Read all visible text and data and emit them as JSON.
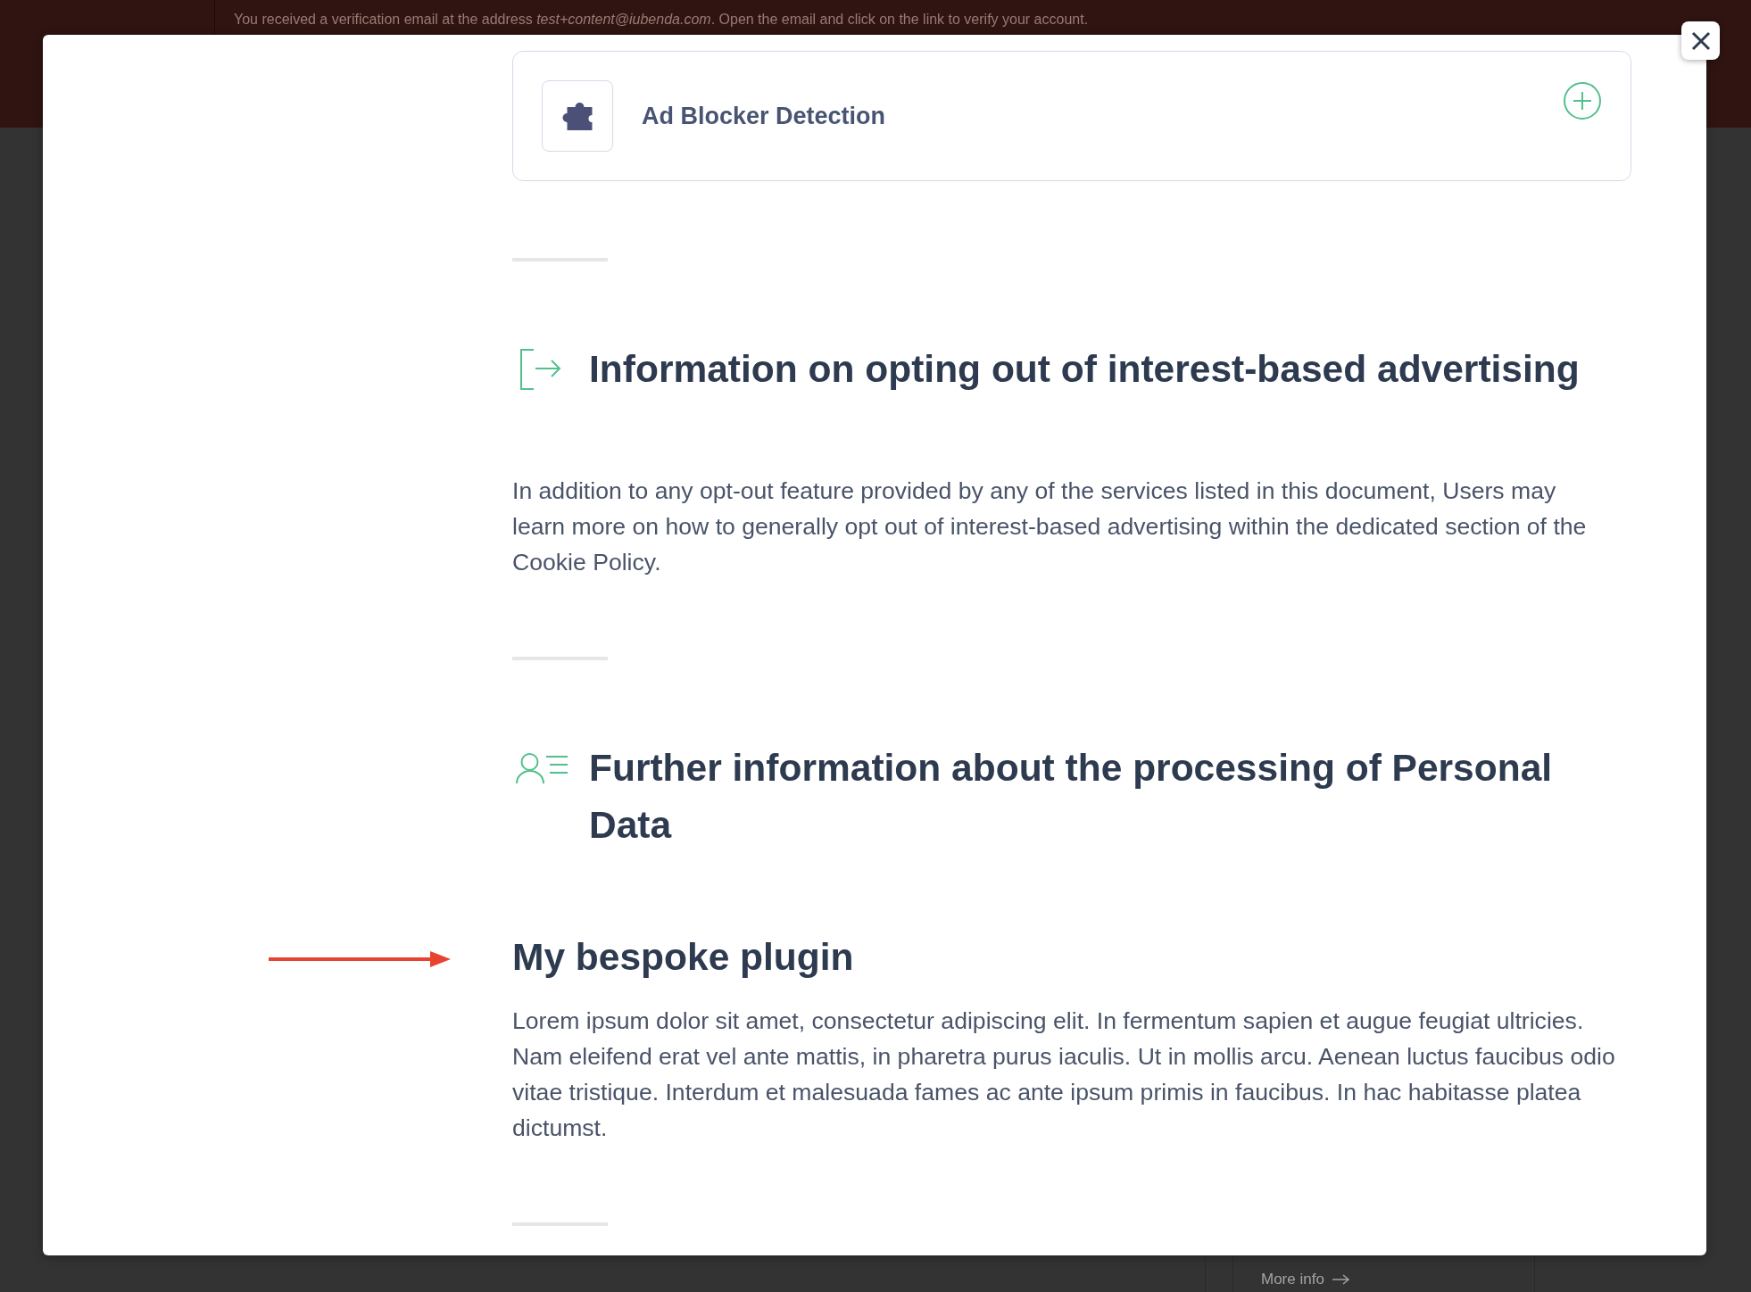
{
  "banner": {
    "message": "You received a verification email at the address *test+content@iubenda.com*. Open the email and click on the link to verify your account."
  },
  "modal": {
    "service_card": {
      "title": "Ad Blocker Detection",
      "expanded": false
    },
    "sections": [
      {
        "title": "Information on opting out of interest-based advertising",
        "blocks": [
          {
            "kind": "paragraph",
            "text": "In addition to any opt-out feature provided by any of the services listed in this document, Users may learn more on how to generally opt out of interest-based advertising within the dedicated section of the Cookie Policy."
          }
        ]
      },
      {
        "title": "Further information about the processing of Personal Data",
        "blocks": [
          {
            "kind": "subsection",
            "title": "My bespoke plugin",
            "text": "Lorem ipsum dolor sit amet, consectetur adipiscing elit. In fermentum sapien et augue feugiat ultricies. Nam eleifend erat vel ante mattis, in pharetra purus iaculis. Ut in mollis arcu. Aenean luctus faucibus odio vitae tristique. Interdum et malesuada fames ac ante ipsum primis in faucibus. In hac habitasse platea dictumst."
          }
        ]
      }
    ]
  },
  "background": {
    "link": "More info"
  }
}
